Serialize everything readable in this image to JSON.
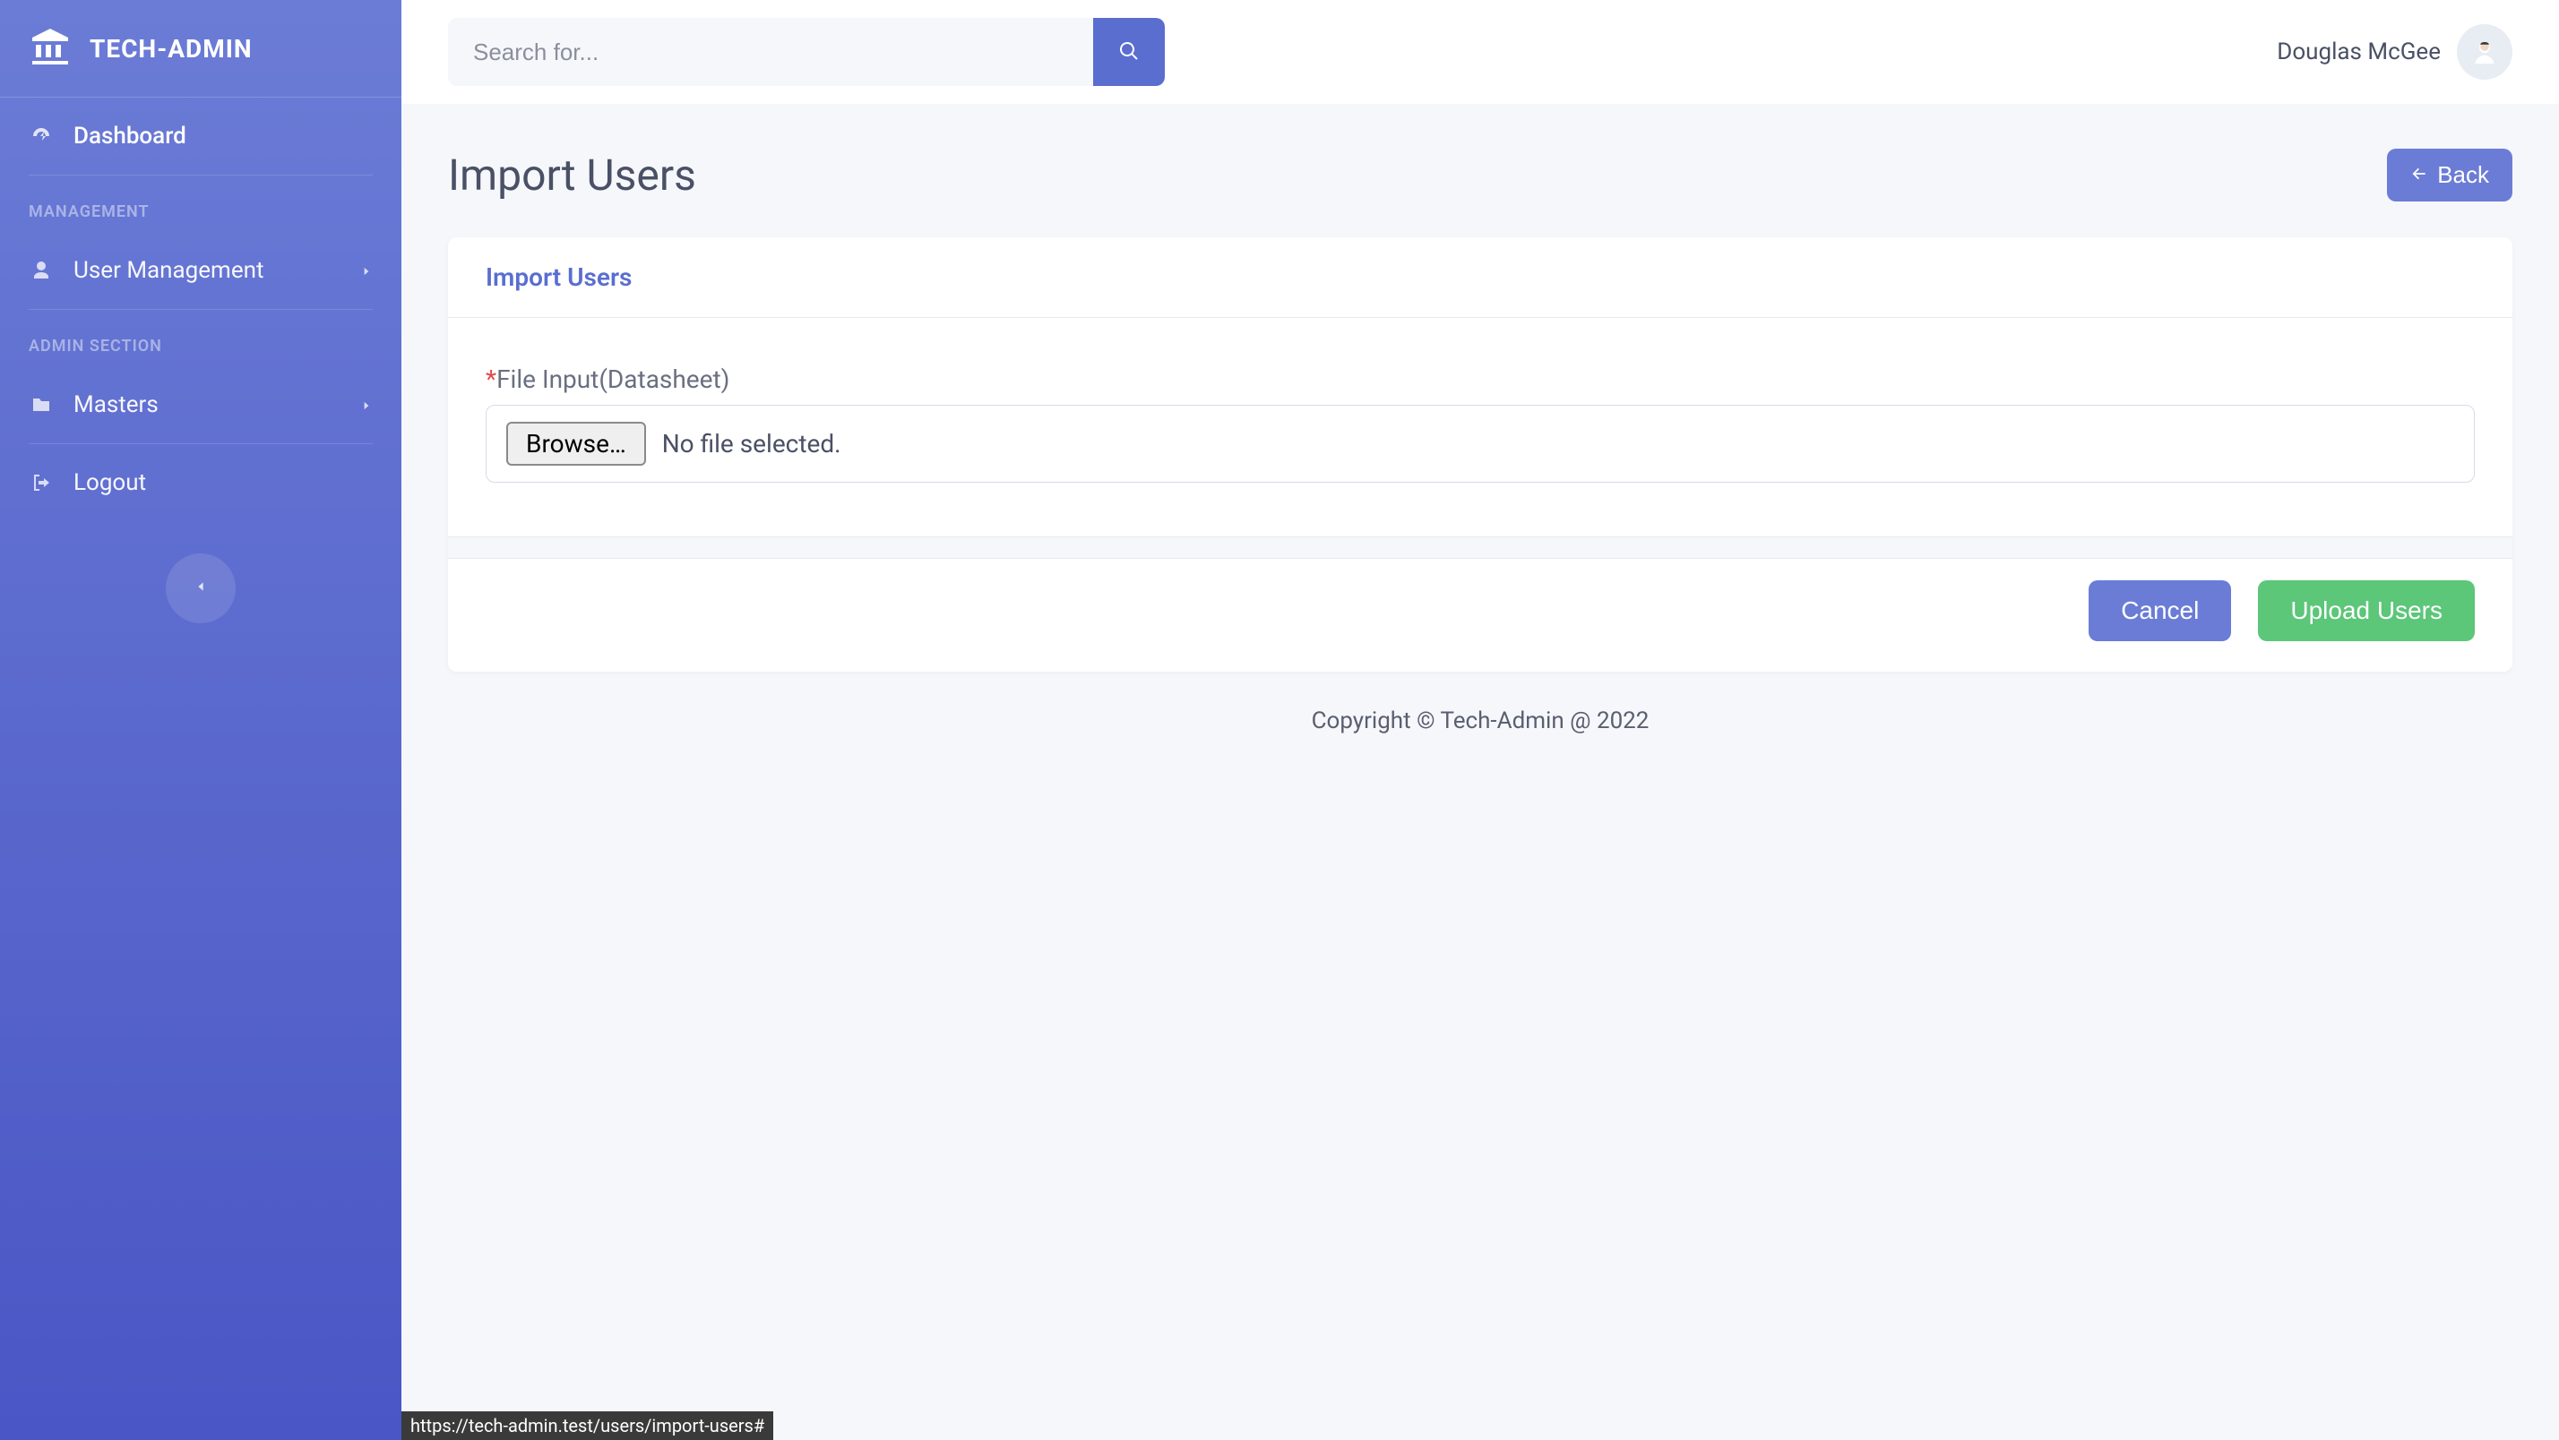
{
  "brand": {
    "name": "TECH-ADMIN"
  },
  "sidebar": {
    "dashboard": "Dashboard",
    "section_management": "MANAGEMENT",
    "user_management": "User Management",
    "section_admin": "ADMIN SECTION",
    "masters": "Masters",
    "logout": "Logout"
  },
  "topbar": {
    "search_placeholder": "Search for...",
    "user_name": "Douglas McGee"
  },
  "page": {
    "title": "Import Users",
    "back": "Back",
    "card_title": "Import Users",
    "file_label": "File Input(Datasheet)",
    "browse_label": "Browse…",
    "file_status": "No file selected.",
    "cancel": "Cancel",
    "upload": "Upload Users"
  },
  "footer": {
    "text": "Copyright © Tech-Admin @ 2022"
  },
  "status_url": "https://tech-admin.test/users/import-users#"
}
